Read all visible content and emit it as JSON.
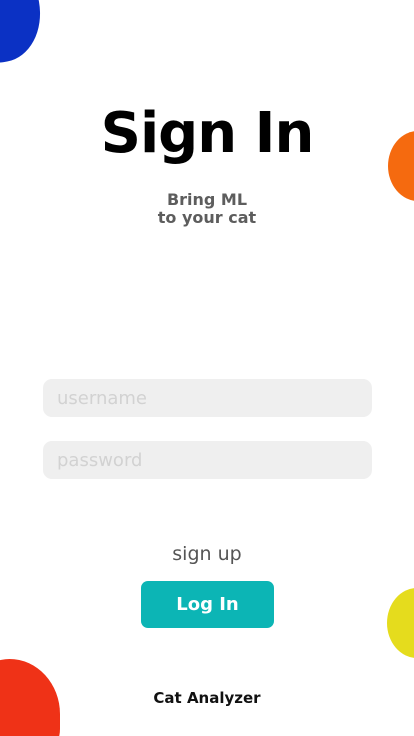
{
  "header": {
    "title": "Sign In",
    "subtitle_line1": "Bring ML",
    "subtitle_line2": "to your cat"
  },
  "form": {
    "username_placeholder": "username",
    "password_placeholder": "password",
    "username_value": "",
    "password_value": ""
  },
  "actions": {
    "signup_label": "sign up",
    "login_label": "Log In"
  },
  "footer": {
    "app_name": "Cat Analyzer"
  },
  "colors": {
    "accent": "#0cb5b5",
    "blob_blue": "#0b31c4",
    "blob_orange": "#f56a0f",
    "blob_yellow": "#e5dc1d",
    "blob_red": "#ef3217"
  }
}
